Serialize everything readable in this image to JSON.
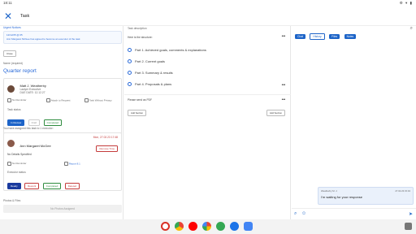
{
  "status_bar": {
    "time": "18:11",
    "icons": "⚙ ▾ ▮"
  },
  "header": {
    "title": "Task",
    "close_icon": "close-icon"
  },
  "urgent": {
    "label": "Urgent Notices",
    "date": "12/12/25 @ 05",
    "message": "Ann Margaret McGee has agreed to become an executor of the task",
    "close": "Close"
  },
  "task": {
    "name_label": "Name (required)",
    "name": "Quarter report"
  },
  "owner": {
    "name": "Matt J. Weatherby",
    "role": "Lawyer Executive",
    "due": "DUE DATE: 12.12.27",
    "reminder": "No Reminder",
    "attach": "Attach to Request",
    "privacy": "Task Without Privacy",
    "status_label": "Task status",
    "statuses": [
      "In Review",
      "Draft",
      "Completed"
    ]
  },
  "assign": {
    "label": "You have assigned this task to 1 executor:",
    "name": "Ann Margaret McGee",
    "time": "Mon, 27.02.23 17:48",
    "remove": "Remove Time",
    "details": "No Details Specified",
    "reminder": "No Reminder",
    "report": "Report 8.1",
    "status_label": "Executor status",
    "statuses": [
      "Ready",
      "Rework",
      "Completed",
      "Deleted"
    ]
  },
  "photos": {
    "label": "Photos & Files",
    "empty": "No Photos Assigned"
  },
  "description": {
    "label": "Task description",
    "intro": "Here is the structure:",
    "parts": [
      "Part 1. Achieved goals, comments & explanations",
      "Part 2. Current goals",
      "Part 3. Summary & results",
      "Part 4. Proposals & plans"
    ],
    "footer": "Please send as PDF",
    "add_left": "Add Section",
    "add_right": "Add Section"
  },
  "chat": {
    "tabs": [
      "Chat",
      "History",
      "Files",
      "Notes"
    ],
    "sender": "Weatherby M. J.",
    "stamp": "27.02.23 15:43",
    "message": "I'm waiting for your response",
    "placeholder": ""
  },
  "dock": {
    "apps": [
      "gmail-icon",
      "chrome-icon",
      "youtube-icon",
      "photos-icon",
      "play-store-icon",
      "messages-icon",
      "files-icon",
      "settings-icon"
    ]
  }
}
